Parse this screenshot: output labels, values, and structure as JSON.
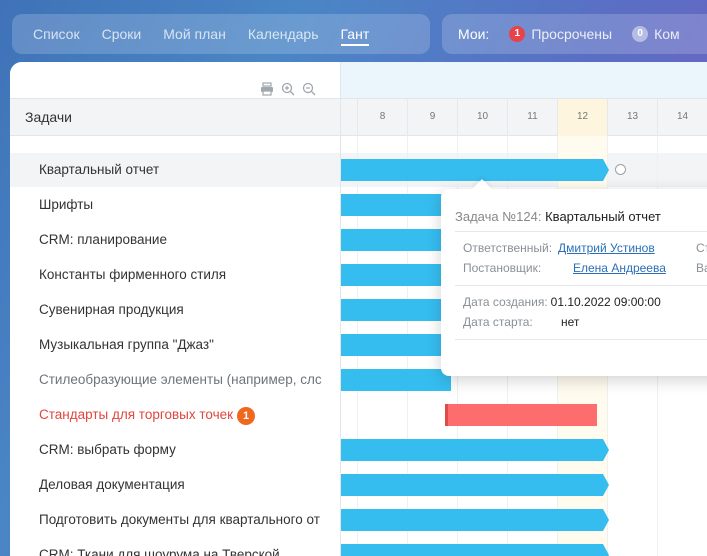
{
  "nav": {
    "tabs": [
      {
        "label": "Список"
      },
      {
        "label": "Сроки"
      },
      {
        "label": "Мой план"
      },
      {
        "label": "Календарь"
      },
      {
        "label": "Гант",
        "active": true
      }
    ]
  },
  "filters": {
    "label": "Мои:",
    "items": [
      {
        "count": "1",
        "label": "Просрочены",
        "color": "#e8434a"
      },
      {
        "count": "0",
        "label": "Ком"
      }
    ]
  },
  "tasks_header": "Задачи",
  "tasks": [
    {
      "label": "Квартальный отчет",
      "style": "hl"
    },
    {
      "label": "Шрифты"
    },
    {
      "label": "CRM: планирование"
    },
    {
      "label": "Константы фирменного стиля"
    },
    {
      "label": "Сувенирная продукция"
    },
    {
      "label": "Музыкальная группа \"Джаз\""
    },
    {
      "label": "Стилеобразующие элементы (например, слс",
      "style": "grey"
    },
    {
      "label": "Стандарты для торговых точек",
      "style": "red",
      "count": "1"
    },
    {
      "label": "CRM: выбрать форму"
    },
    {
      "label": "Деловая документация"
    },
    {
      "label": "Подготовить документы для квартального от"
    },
    {
      "label": "CRM: Ткани для шоурума на Тверской"
    }
  ],
  "gantt": {
    "days": [
      "8",
      "9",
      "10",
      "11",
      "12",
      "13",
      "14"
    ],
    "today": "12"
  },
  "popup": {
    "title_prefix": "Задача №124:",
    "title_name": "Квартальный отчет",
    "responsible_label": "Ответственный:",
    "responsible_value": "Дмитрий Устинов",
    "creator_label": "Постановщик:",
    "creator_value": "Елена Андреева",
    "created_label": "Дата создания:",
    "created_value": "01.10.2022 09:00:00",
    "start_label": "Дата старта:",
    "start_value": "нет",
    "cut_right_1": "Ст",
    "cut_right_2": "Ва"
  },
  "colors": {
    "bar_blue": "#36bdf0",
    "bar_red": "#fd6d6d",
    "overdue_text": "#e0463d"
  }
}
